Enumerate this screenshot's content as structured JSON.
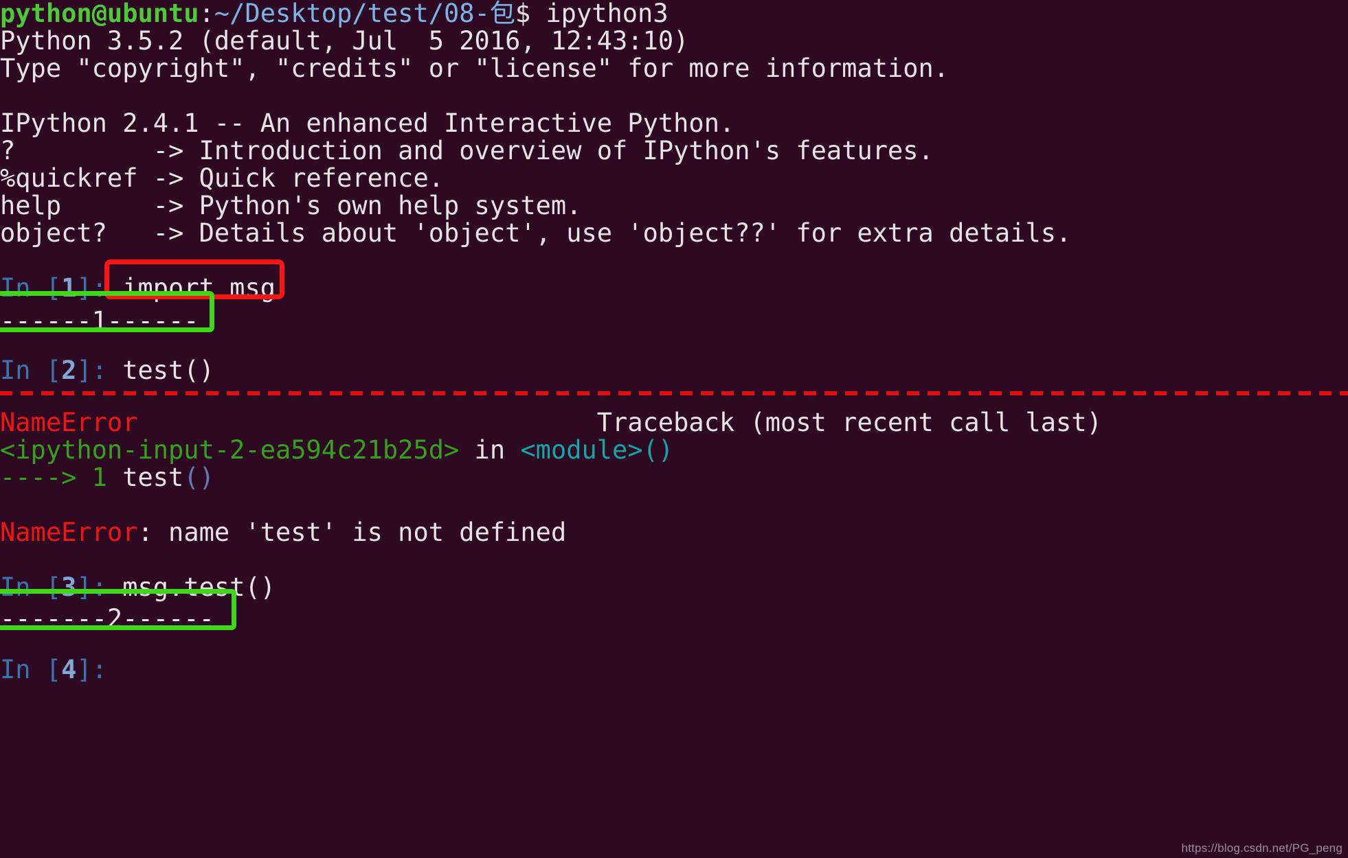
{
  "terminal": {
    "background_color": "#2d0a22",
    "foreground_color": "#e8e3e6",
    "prompt": {
      "user_host": "python@ubuntu",
      "colon": ":",
      "path": "~/Desktop/test/08-包",
      "dollar": "$",
      "command": " ipython3"
    },
    "banner": [
      "Python 3.5.2 (default, Jul  5 2016, 12:43:10)",
      "Type \"copyright\", \"credits\" or \"license\" for more information.",
      "",
      "IPython 2.4.1 -- An enhanced Interactive Python.",
      "?         -> Introduction and overview of IPython's features.",
      "%quickref -> Quick reference.",
      "help      -> Python's own help system.",
      "object?   -> Details about 'object', use 'object??' for extra details."
    ],
    "cells": [
      {
        "prompt_in": "In ",
        "prompt_open": "[",
        "prompt_number": "1",
        "prompt_close": "]:",
        "input": "import msg",
        "output": "------1------"
      },
      {
        "prompt_in": "In ",
        "prompt_open": "[",
        "prompt_number": "2",
        "prompt_close": "]:",
        "input": "test()",
        "output": ""
      },
      {
        "prompt_in": "In ",
        "prompt_open": "[",
        "prompt_number": "3",
        "prompt_close": "]:",
        "input": "msg.test()",
        "output": "-------2------"
      },
      {
        "prompt_in": "In ",
        "prompt_open": "[",
        "prompt_number": "4",
        "prompt_close": "]:",
        "input": "",
        "output": ""
      }
    ],
    "traceback": {
      "separator": "---------------------------------------------------------------------------",
      "exception_name": "NameError",
      "header_right": "Traceback (most recent call last)",
      "location_file": "<ipython-input-2-ea594c21b25d>",
      "location_in": " in ",
      "location_scope": "<module>",
      "location_scope_parens": "()",
      "arrow_line_marker": "----> 1 ",
      "arrow_line_code": "test",
      "arrow_line_parens": "()",
      "message_label": "NameError",
      "message_colon": ": ",
      "message_text": "name 'test' is not defined"
    },
    "annotations": [
      {
        "id": "red-box-import-msg",
        "color": "#fb1616",
        "shape": "rectangle",
        "target": "import msg"
      },
      {
        "id": "green-box-output-1",
        "color": "#3fd817",
        "shape": "rectangle",
        "target": "------1------"
      },
      {
        "id": "green-box-output-2",
        "color": "#3fd817",
        "shape": "rectangle",
        "target": "-------2------"
      }
    ],
    "watermark": "https://blog.csdn.net/PG_peng"
  }
}
